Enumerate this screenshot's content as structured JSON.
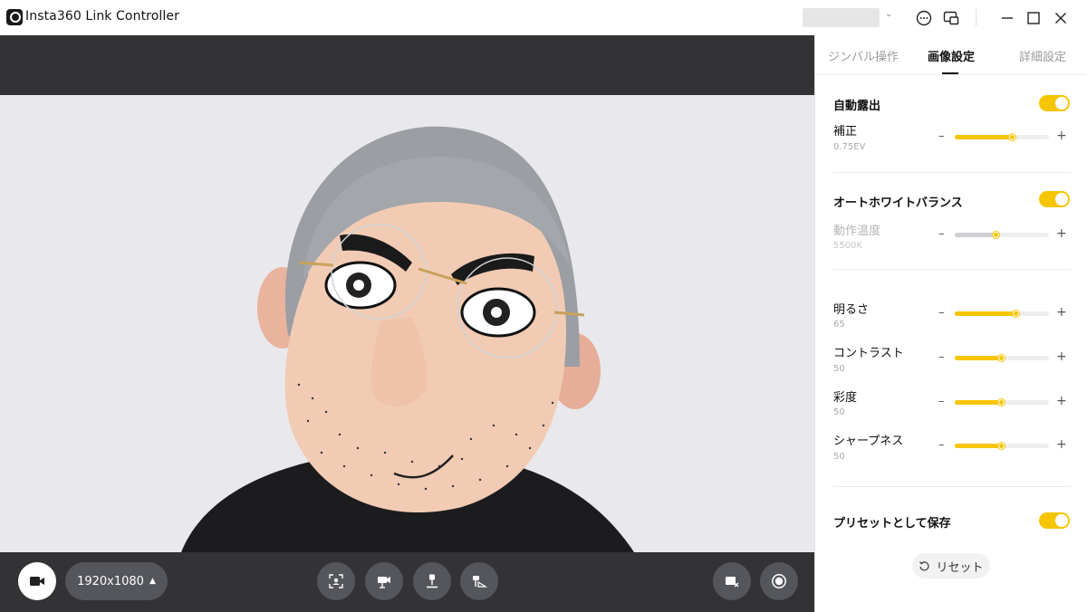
{
  "app": {
    "title": "Insta360 Link Controller"
  },
  "tabs": [
    {
      "label": "ジンバル操作"
    },
    {
      "label": "画像設定"
    },
    {
      "label": "詳細設定"
    }
  ],
  "settings": {
    "auto_exposure": {
      "label": "自動露出",
      "enabled": true
    },
    "exposure_comp": {
      "label": "補正",
      "value": "0.75EV",
      "level": 0.62
    },
    "awb": {
      "label": "オートホワイトバランス",
      "enabled": true
    },
    "color_temp": {
      "label": "動作温度",
      "value": "5500K",
      "level": 0.44,
      "disabled": true
    },
    "brightness": {
      "label": "明るさ",
      "value": "65",
      "level": 0.65
    },
    "contrast": {
      "label": "コントラスト",
      "value": "50",
      "level": 0.5
    },
    "saturation": {
      "label": "彩度",
      "value": "50",
      "level": 0.5
    },
    "sharpness": {
      "label": "シャープネス",
      "value": "50",
      "level": 0.5
    },
    "save_preset": {
      "label": "プリセットとして保存",
      "enabled": true
    },
    "reset_label": "リセット"
  },
  "bottom_bar": {
    "resolution": "1920x1080"
  },
  "colors": {
    "accent": "#f7c500",
    "dark_bar": "#333335",
    "button": "#54565c"
  },
  "icons": [
    "camera-icon",
    "chevron-up-icon",
    "face-frame-icon",
    "tracking-icon",
    "overhead-icon",
    "desk-mode-icon",
    "hide-privacy-icon",
    "record-icon",
    "more-icon",
    "pip-icon",
    "minimize-icon",
    "maximize-icon",
    "close-icon",
    "refresh-icon"
  ]
}
